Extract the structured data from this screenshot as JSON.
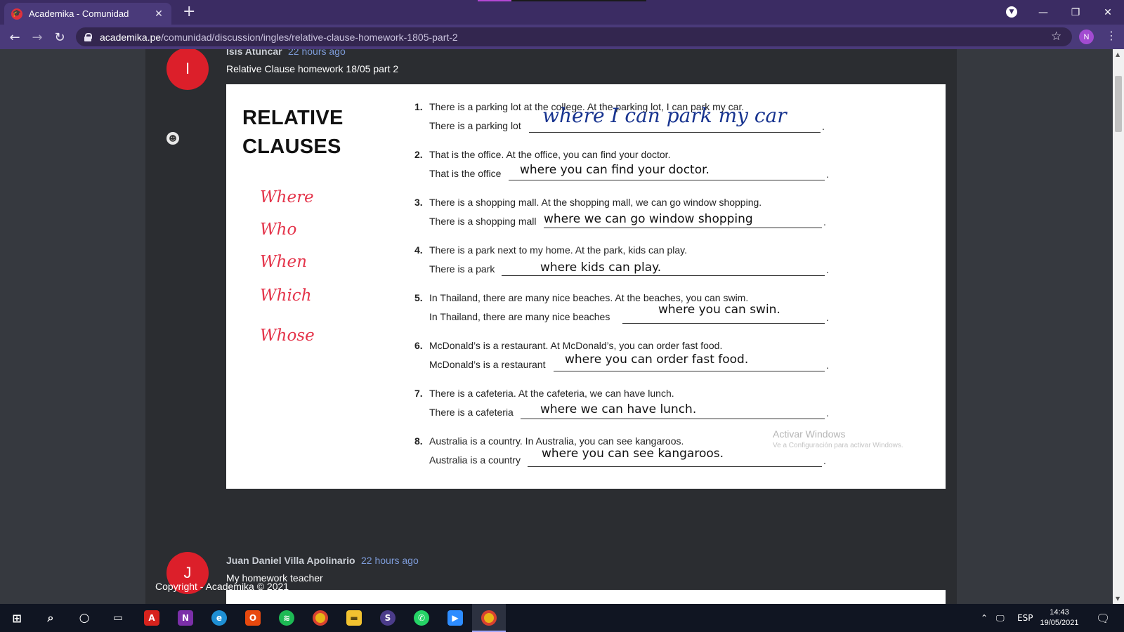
{
  "browser": {
    "tab_title": "Academika - Comunidad",
    "url_host": "academika.pe",
    "url_path": "/comunidad/discussion/ingles/relative-clause-homework-1805-part-2",
    "profile_initial": "N"
  },
  "posts": [
    {
      "avatar_initial": "I",
      "author": "Isis Atuncar",
      "time": "22 hours ago",
      "text": "Relative Clause homework 18/05 part 2"
    },
    {
      "avatar_initial": "J",
      "author": "Juan Daniel Villa Apolinario",
      "time": "22 hours ago",
      "text": "My homework teacher"
    }
  ],
  "worksheet": {
    "title_line1": "RELATIVE",
    "title_line2": "CLAUSES",
    "pronouns": [
      "Where",
      "Who",
      "When",
      "Which",
      "Whose"
    ],
    "items": [
      {
        "num": "1.",
        "question": "There is a parking lot at the college.  At the parking lot, I can park my car.",
        "prompt": "There is a parking lot",
        "answer": "where I can park my car"
      },
      {
        "num": "2.",
        "question": "That is the office.  At the office, you can find your doctor.",
        "prompt": "That is the office",
        "answer": "where you can find your doctor."
      },
      {
        "num": "3.",
        "question": "There is a shopping mall.  At the shopping mall, we can go window shopping.",
        "prompt": "There is a shopping mall",
        "answer": "where we can go window shopping"
      },
      {
        "num": "4.",
        "question": "There is a park next to my home.  At the park, kids can play.",
        "prompt": "There is a park",
        "answer": "where kids can play."
      },
      {
        "num": "5.",
        "question": "In Thailand, there are many nice beaches.  At the beaches, you can swim.",
        "prompt": "In Thailand, there are many nice beaches",
        "answer": "where you can swin."
      },
      {
        "num": "6.",
        "question": "McDonald’s is a restaurant.  At McDonald’s, you can order fast food.",
        "prompt": "McDonald’s is a restaurant",
        "answer": "where you can order fast food."
      },
      {
        "num": "7.",
        "question": "There is a cafeteria.  At the cafeteria, we can have lunch.",
        "prompt": "There is a cafeteria",
        "answer": "where we can have lunch."
      },
      {
        "num": "8.",
        "question": "Australia is a country.  In Australia, you can see kangaroos.",
        "prompt": "Australia is a country",
        "answer": "where you can see kangaroos."
      }
    ],
    "period": ".",
    "watermark_title": "Activar Windows",
    "watermark_sub": "Ve a Configuración para activar Windows."
  },
  "footer": {
    "copyright": "Copyright - Academika © 2021"
  },
  "taskbar": {
    "apps": [
      "start-icon",
      "search-icon",
      "cortana-icon",
      "task-view-icon",
      "acrobat-icon",
      "onenote-icon",
      "edge-icon",
      "office-icon",
      "spotify-icon",
      "chrome-icon",
      "file-explorer-icon",
      "app-s-icon",
      "whatsapp-icon",
      "zoom-icon",
      "chrome-profile-icon"
    ],
    "language": "ESP",
    "time": "14:43",
    "date": "19/05/2021"
  },
  "colors": {
    "accent_red": "#dc1f2a",
    "browser_purple": "#3b2c63",
    "time_blue": "#7d9bd8",
    "handwriting_red": "#e4344a",
    "handwriting_blue": "#17338f"
  }
}
